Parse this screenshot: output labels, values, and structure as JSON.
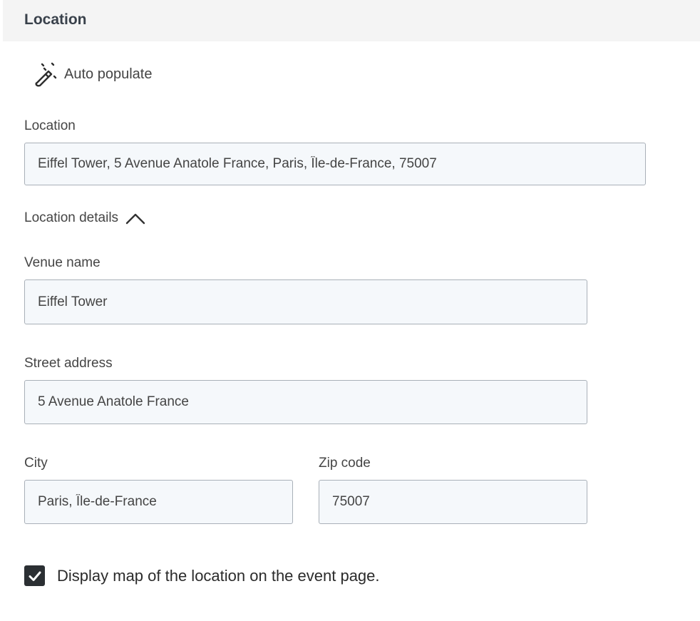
{
  "header": {
    "title": "Location"
  },
  "auto_populate": {
    "label": "Auto populate",
    "icon": "magic-wand-icon"
  },
  "location": {
    "label": "Location",
    "value": "Eiffel Tower, 5 Avenue Anatole France, Paris, Île-de-France, 75007"
  },
  "details_toggle": {
    "label": "Location details",
    "icon": "chevron-up-icon",
    "expanded": true
  },
  "venue": {
    "label": "Venue name",
    "value": "Eiffel Tower"
  },
  "street": {
    "label": "Street address",
    "value": "5 Avenue Anatole France"
  },
  "city": {
    "label": "City",
    "value": "Paris, Île-de-France"
  },
  "zip": {
    "label": "Zip code",
    "value": "75007"
  },
  "map_option": {
    "label": "Display map of the location on the event page.",
    "checked": true
  },
  "colors": {
    "header_bg": "#f4f4f4",
    "input_bg": "#f5f8fb",
    "input_border": "#a9b0b8",
    "checkbox_bg": "#2b2f33"
  }
}
